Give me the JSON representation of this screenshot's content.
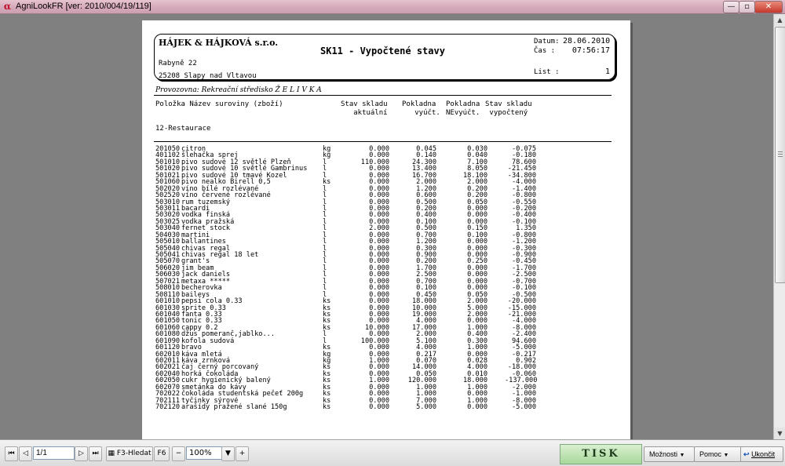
{
  "window": {
    "title": "AgniLookFR [ver: 2010/004/19/119]",
    "app_icon_glyph": "α",
    "btn_min": "—",
    "btn_max": "▫",
    "btn_close": "✕"
  },
  "report": {
    "company": "HÁJEK & HÁJKOVÁ s.r.o.",
    "title": "SK11 - Vypočtené stavy",
    "street": "Rabyně 22",
    "city": "25208 Slapy nad Vltavou",
    "date_label": "Datum:",
    "date_value": "28.06.2010",
    "time_label": "Čas   :",
    "time_value": "07:56:17",
    "list_label": "List   :",
    "list_value": "1",
    "site": "Provozovna: Rekreační středisko Ž E L I V K A",
    "col_item": "Položka Název suroviny (zboží)",
    "col_stock": "Stav skladu\n   aktuální",
    "col_paid": "Pokladna\n   vyúčt.",
    "col_unpaid": "Pokladna\nNEvyúčt.",
    "col_calc": "Stav skladu\n vypočtený",
    "group": "12-Restaurace",
    "rows": [
      [
        "201050",
        "citron",
        "kg",
        "0.000",
        "0.045",
        "0.030",
        "-0.075"
      ],
      [
        "401102",
        "šlehačka sprej",
        "kg",
        "0.000",
        "0.140",
        "0.040",
        "-0.180"
      ],
      [
        "501010",
        "pivo sudové 12 světlé Plzeň",
        "l",
        "110.000",
        "24.300",
        "7.100",
        "78.600"
      ],
      [
        "501020",
        "pivo sudové 10 světlé Gambrinus",
        "l",
        "0.000",
        "13.400",
        "8.050",
        "-21.450"
      ],
      [
        "501021",
        "pivo sudové 10 tmavé Kozel",
        "l",
        "0.000",
        "16.700",
        "18.100",
        "-34.800"
      ],
      [
        "501060",
        "pivo nealko Birell 0,5",
        "ks",
        "0.000",
        "2.000",
        "2.000",
        "-4.000"
      ],
      [
        "502020",
        "víno bílé rozlévané",
        "l",
        "0.000",
        "1.200",
        "0.200",
        "-1.400"
      ],
      [
        "502520",
        "víno červené rozlévané",
        "l",
        "0.000",
        "0.600",
        "0.200",
        "-0.800"
      ],
      [
        "503010",
        "rum tuzemský",
        "l",
        "0.000",
        "0.500",
        "0.050",
        "-0.550"
      ],
      [
        "503011",
        "bacardi",
        "l",
        "0.000",
        "0.200",
        "0.000",
        "-0.200"
      ],
      [
        "503020",
        "vodka finská",
        "l",
        "0.000",
        "0.400",
        "0.000",
        "-0.400"
      ],
      [
        "503025",
        "vodka pražská",
        "l",
        "0.000",
        "0.100",
        "0.000",
        "-0.100"
      ],
      [
        "503040",
        "fernet stock",
        "l",
        "2.000",
        "0.500",
        "0.150",
        "1.350"
      ],
      [
        "504030",
        "martini",
        "l",
        "0.000",
        "0.700",
        "0.100",
        "-0.800"
      ],
      [
        "505010",
        "ballantines",
        "l",
        "0.000",
        "1.200",
        "0.000",
        "-1.200"
      ],
      [
        "505040",
        "chivas regal",
        "l",
        "0.000",
        "0.300",
        "0.000",
        "-0.300"
      ],
      [
        "505041",
        "chivas regal 18 let",
        "l",
        "0.000",
        "0.900",
        "0.000",
        "-0.900"
      ],
      [
        "505070",
        "grant's",
        "l",
        "0.000",
        "0.200",
        "0.250",
        "-0.450"
      ],
      [
        "506020",
        "jim beam",
        "l",
        "0.000",
        "1.700",
        "0.000",
        "-1.700"
      ],
      [
        "506030",
        "jack daniels",
        "l",
        "0.000",
        "2.500",
        "0.000",
        "-2.500"
      ],
      [
        "507021",
        "metaxa *****",
        "l",
        "0.000",
        "0.700",
        "0.000",
        "-0.700"
      ],
      [
        "508010",
        "becherovka",
        "l",
        "0.000",
        "0.100",
        "0.000",
        "-0.100"
      ],
      [
        "508110",
        "baileys",
        "l",
        "0.000",
        "0.450",
        "0.050",
        "-0.500"
      ],
      [
        "601010",
        "pepsi cola 0.33",
        "ks",
        "0.000",
        "18.000",
        "2.000",
        "-20.000"
      ],
      [
        "601030",
        "sprite 0.33",
        "ks",
        "0.000",
        "10.000",
        "5.000",
        "-15.000"
      ],
      [
        "601040",
        "fanta 0.33",
        "ks",
        "0.000",
        "19.000",
        "2.000",
        "-21.000"
      ],
      [
        "601050",
        "tonic 0.33",
        "ks",
        "0.000",
        "4.000",
        "0.000",
        "-4.000"
      ],
      [
        "601060",
        "cappy 0.2",
        "ks",
        "10.000",
        "17.000",
        "1.000",
        "-8.000"
      ],
      [
        "601080",
        "džus pomeranč,jablko...",
        "l",
        "0.000",
        "2.000",
        "0.400",
        "-2.400"
      ],
      [
        "601090",
        "kofola sudová",
        "l",
        "100.000",
        "5.100",
        "0.300",
        "94.600"
      ],
      [
        "601120",
        "bravo",
        "ks",
        "0.000",
        "4.000",
        "1.000",
        "-5.000"
      ],
      [
        "602010",
        "káva mletá",
        "kg",
        "0.000",
        "0.217",
        "0.000",
        "-0.217"
      ],
      [
        "602011",
        "káva zrnková",
        "kg",
        "1.000",
        "0.070",
        "0.028",
        "0.902"
      ],
      [
        "602021",
        "čaj černý porcovaný",
        "ks",
        "0.000",
        "14.000",
        "4.000",
        "-18.000"
      ],
      [
        "602040",
        "horká čokoláda",
        "ks",
        "0.000",
        "0.050",
        "0.010",
        "-0.060"
      ],
      [
        "602050",
        "cukr hygienický balený",
        "ks",
        "1.000",
        "120.000",
        "18.000",
        "-137.000"
      ],
      [
        "602070",
        "smetánka do kávy",
        "ks",
        "0.000",
        "1.000",
        "1.000",
        "-2.000"
      ],
      [
        "702022",
        "čokoláda studentská pečeť 200g",
        "ks",
        "0.000",
        "1.000",
        "0.000",
        "-1.000"
      ],
      [
        "702111",
        "tyčinky sýrové",
        "ks",
        "0.000",
        "7.000",
        "1.000",
        "-8.000"
      ],
      [
        "702120",
        "arašídy pražené slané 150g",
        "ks",
        "0.000",
        "5.000",
        "0.000",
        "-5.000"
      ]
    ]
  },
  "toolbar": {
    "first_icon": "⏮",
    "prev_icon": "◁",
    "page_value": "1/1",
    "next_icon": "▷",
    "last_icon": "⏭",
    "search_label": "F3-Hledat",
    "f6_label": "F6",
    "zoom_out_icon": "−",
    "zoom_value": "100%",
    "zoom_dropdown_icon": "▼",
    "zoom_in_icon": "+",
    "print_label": "TISK",
    "options_label": "Možnosti",
    "help_label": "Pomoc",
    "exit_label": "Ukončit",
    "dropdown_icon": "▼",
    "exit_icon": "↩"
  },
  "scrollbar": {
    "up_icon": "▲",
    "down_icon": "▼"
  },
  "colors": {
    "accent_print": "#a8d89a",
    "titlebar": "#d6a9b9"
  }
}
